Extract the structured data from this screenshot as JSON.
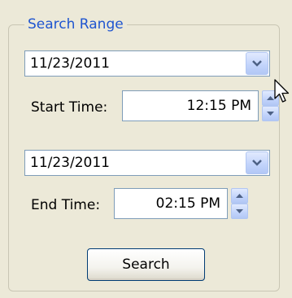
{
  "group": {
    "title": "Search Range"
  },
  "start": {
    "date": "11/23/2011",
    "time_label": "Start Time:",
    "time": "12:15 PM"
  },
  "end": {
    "date": "11/23/2011",
    "time_label": "End Time:",
    "time": "02:15 PM"
  },
  "search_label": "Search",
  "icons": {
    "dropdown": "chevron-down-icon",
    "spin_up": "arrow-up-icon",
    "spin_down": "arrow-down-icon",
    "cursor": "mouse-pointer-icon"
  },
  "colors": {
    "background": "#ece9d8",
    "group_title": "#1f55d0",
    "input_border": "#7f9db9",
    "button_border": "#003c74"
  }
}
